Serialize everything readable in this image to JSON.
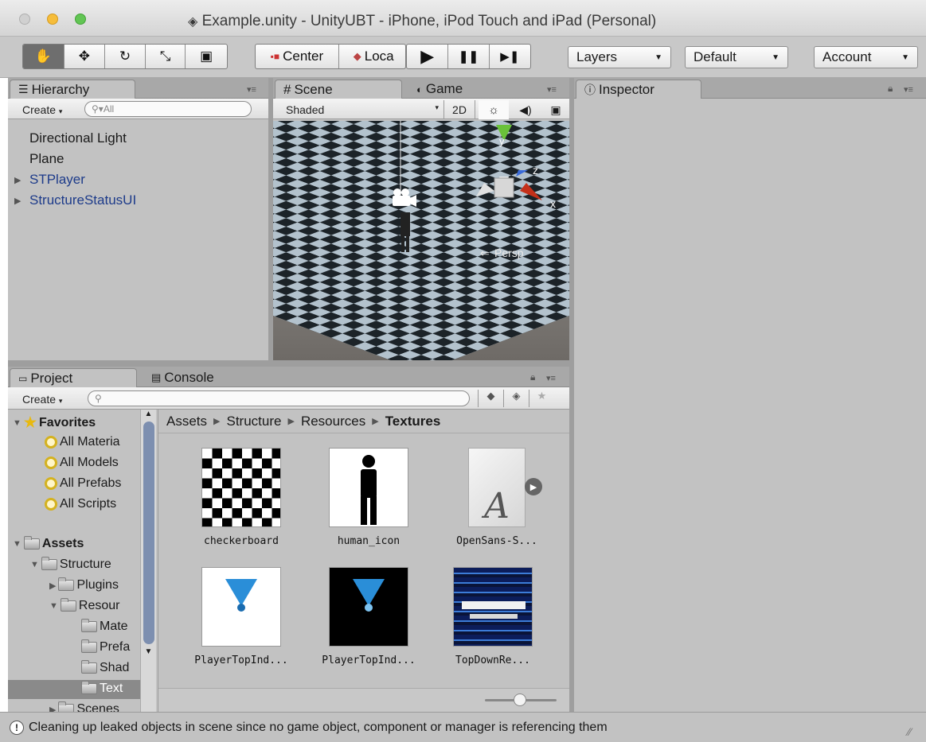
{
  "window": {
    "title": "Example.unity - UnityUBT - iPhone, iPod Touch and iPad (Personal)"
  },
  "toolbar": {
    "tools": [
      {
        "icon": "hand-icon",
        "glyph": "✋"
      },
      {
        "icon": "move-icon",
        "glyph": "✥"
      },
      {
        "icon": "rotate-icon",
        "glyph": "↻"
      },
      {
        "icon": "scale-icon",
        "glyph": "⤡"
      },
      {
        "icon": "rect-tool-icon",
        "glyph": "▣"
      }
    ],
    "pivot_label": "Center",
    "space_label": "Loca",
    "play_glyph": "▶",
    "pause_glyph": "❚❚",
    "step_glyph": "▶❚",
    "layers_label": "Layers",
    "layout_label": "Default",
    "account_label": "Account"
  },
  "hierarchy": {
    "tab_label": "Hierarchy",
    "create_label": "Create",
    "search_placeholder": "All",
    "items": [
      {
        "label": "Directional Light"
      },
      {
        "label": "Plane"
      },
      {
        "label": "STPlayer"
      },
      {
        "label": "StructureStatusUI"
      }
    ]
  },
  "scene": {
    "tab_label": "Scene",
    "game_tab_label": "Game",
    "shading_mode": "Shaded",
    "mode_2d": "2D",
    "persp_label": "Persp",
    "axis_y": "y",
    "axis_x": "x",
    "axis_z": "z"
  },
  "inspector": {
    "tab_label": "Inspector"
  },
  "project": {
    "tab_label": "Project",
    "console_tab_label": "Console",
    "create_label": "Create",
    "favorites": {
      "label": "Favorites",
      "items": [
        {
          "label": "All Materia"
        },
        {
          "label": "All Models"
        },
        {
          "label": "All Prefabs"
        },
        {
          "label": "All Scripts"
        }
      ]
    },
    "assets": {
      "label": "Assets",
      "structure": "Structure",
      "plugins": "Plugins",
      "resources": "Resour",
      "mate": "Mate",
      "prefa": "Prefa",
      "shad": "Shad",
      "text": "Text",
      "scenes": "Scenes"
    },
    "breadcrumb": [
      {
        "label": "Assets"
      },
      {
        "label": "Structure"
      },
      {
        "label": "Resources"
      },
      {
        "label": "Textures"
      }
    ],
    "assets_grid": [
      {
        "name": "checkerboard"
      },
      {
        "name": "human_icon"
      },
      {
        "name": "OpenSans-S..."
      },
      {
        "name": "PlayerTopInd..."
      },
      {
        "name": "PlayerTopInd..."
      },
      {
        "name": "TopDownRe..."
      }
    ],
    "font_glyph": "A"
  },
  "status": {
    "message": "Cleaning up leaked objects in scene since no game object, component or manager is referencing them"
  }
}
